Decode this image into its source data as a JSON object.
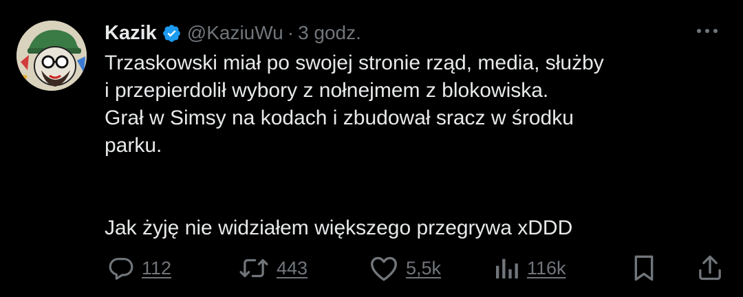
{
  "tweet": {
    "author_name": "Kazik",
    "handle": "@KaziuWu",
    "separator": "·",
    "time": "3 godz.",
    "lines": [
      "Trzaskowski miał po swojej stronie rząd, media, służby",
      "i przepierdolił wybory z nołnejmem z blokowiska.",
      "Grał w Simsy na kodach i zbudował sracz w środku",
      "parku."
    ],
    "last_line": "Jak żyję nie widziałem większego przegrywa xDDD"
  },
  "actions": {
    "replies": "112",
    "reposts": "443",
    "likes": "5,5k",
    "views": "116k"
  },
  "icons": {
    "verified": "verified-badge-icon",
    "more": "more-options-icon",
    "reply": "reply-icon",
    "repost": "repost-icon",
    "like": "heart-icon",
    "views": "views-chart-icon",
    "bookmark": "bookmark-icon",
    "share": "share-icon"
  },
  "colors": {
    "background": "#000000",
    "text": "#e7e9ea",
    "secondary": "#71767b",
    "verified": "#1d9bf0"
  }
}
